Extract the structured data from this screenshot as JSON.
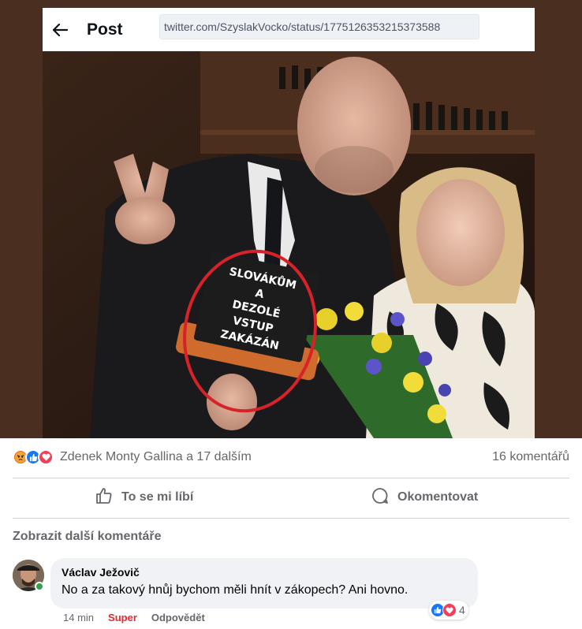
{
  "embedded_post": {
    "title": "Post",
    "url": "twitter.com/SzyslakVocko/status/1775126353215373588",
    "sign_lines": [
      "SLOVÁKŮM",
      "A",
      "DEZOLÉ",
      "VSTUP",
      "ZAKÁZÁN"
    ]
  },
  "reactions": {
    "icons": [
      "angry-icon",
      "like-icon",
      "love-icon"
    ],
    "names": "Zdenek Monty Gallina a 17 dalším",
    "comment_count": "16 komentářů"
  },
  "actions": {
    "like_label": "To se mi líbí",
    "comment_label": "Okomentovat"
  },
  "comments": {
    "more_label": "Zobrazit další komentáře",
    "items": [
      {
        "author": "Václav Ježovič",
        "text": "No a za takový hnůj bychom měli hnít v zákopech? Ani hovno.",
        "time": "14 min",
        "reaction_label": "Super",
        "reply_label": "Odpovědět",
        "reaction_count": "4"
      }
    ]
  },
  "colors": {
    "like": "#1877f2",
    "love": "#f33e58",
    "angry": "#e9710f",
    "circle": "#d8222a"
  }
}
